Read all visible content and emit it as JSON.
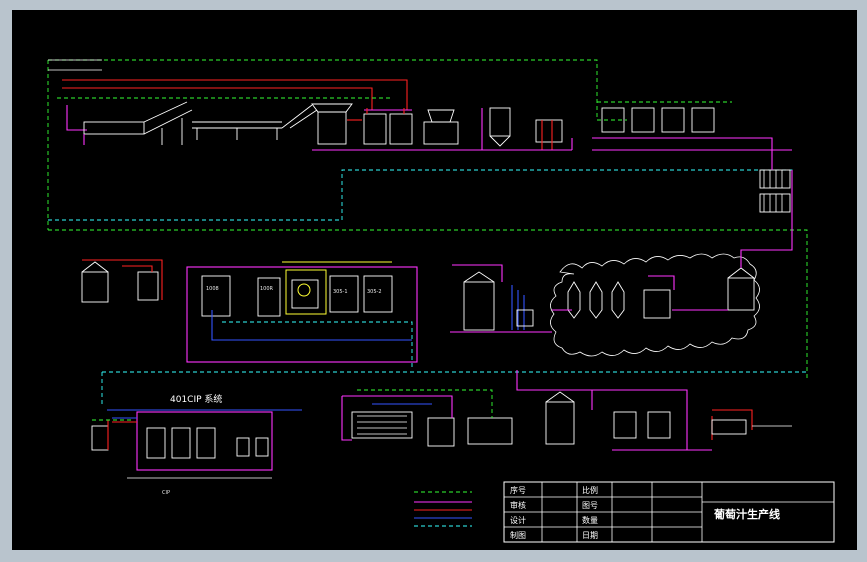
{
  "tanks": {
    "t1": "1008",
    "t2": "100R",
    "t3": "305-1",
    "t4": "305-2"
  },
  "section_label": "401CIP 系统",
  "cip_label": "CIP",
  "title_block": {
    "rows": [
      {
        "left": "序号",
        "right": "比例"
      },
      {
        "left": "审核",
        "right": "图号"
      },
      {
        "left": "设计",
        "right": "数量"
      },
      {
        "left": "制图",
        "right": "日期"
      }
    ],
    "title": "葡萄汁生产线"
  },
  "colors": {
    "background": "#000000",
    "frame": "#b9c4cd",
    "steam": "#33ff33",
    "cooling": "#33ffff",
    "product": "#ff33ff",
    "hot_water": "#ff2222",
    "water": "#3355ff"
  }
}
